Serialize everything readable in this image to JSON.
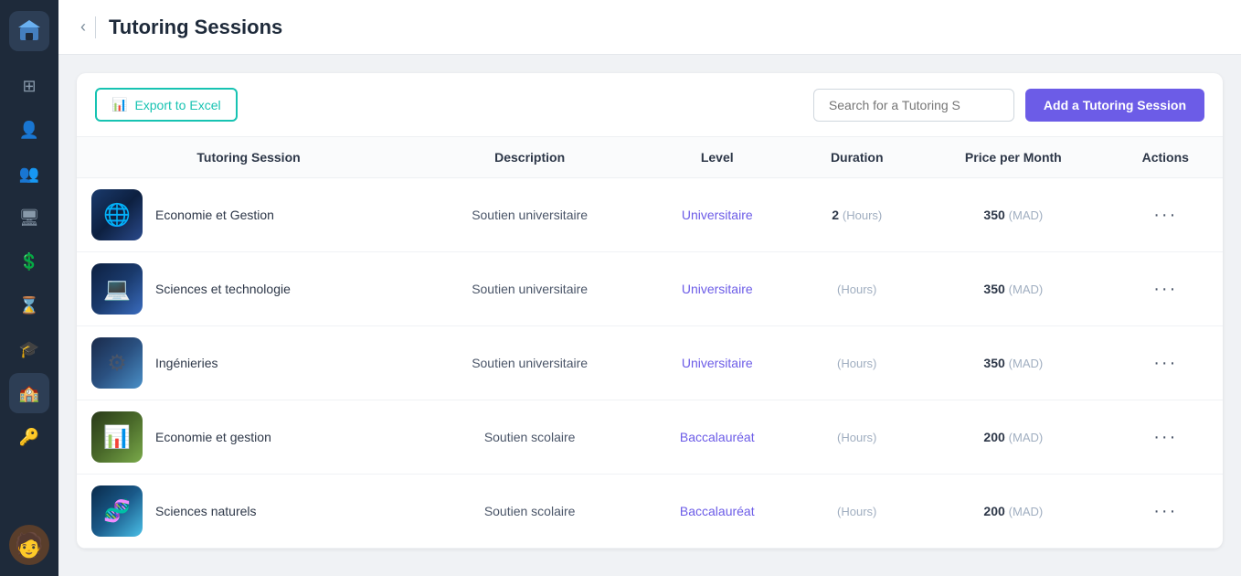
{
  "app": {
    "logo_icon": "🏛",
    "title": "Tutoring Sessions"
  },
  "sidebar": {
    "items": [
      {
        "id": "dashboard",
        "icon": "⊞",
        "label": "Dashboard"
      },
      {
        "id": "students",
        "icon": "👤",
        "label": "Students"
      },
      {
        "id": "people",
        "icon": "👥",
        "label": "People"
      },
      {
        "id": "monitor",
        "icon": "🖥",
        "label": "Monitor"
      },
      {
        "id": "finance",
        "icon": "💲",
        "label": "Finance"
      },
      {
        "id": "schedule",
        "icon": "⌛",
        "label": "Schedule"
      },
      {
        "id": "graduation",
        "icon": "🎓",
        "label": "Graduation"
      },
      {
        "id": "tutoring",
        "icon": "🏫",
        "label": "Tutoring",
        "active": true
      },
      {
        "id": "keys",
        "icon": "🔑",
        "label": "Keys"
      }
    ],
    "avatar_icon": "👤"
  },
  "toolbar": {
    "export_label": "Export to Excel",
    "export_icon": "📊",
    "search_placeholder": "Search for a Tutoring S",
    "add_label": "Add a Tutoring Session"
  },
  "table": {
    "columns": [
      {
        "id": "session",
        "label": "Tutoring Session"
      },
      {
        "id": "description",
        "label": "Description"
      },
      {
        "id": "level",
        "label": "Level"
      },
      {
        "id": "duration",
        "label": "Duration"
      },
      {
        "id": "price",
        "label": "Price per Month"
      },
      {
        "id": "actions",
        "label": "Actions"
      }
    ],
    "rows": [
      {
        "id": 1,
        "name": "Economie et Gestion",
        "thumb_class": "thumb-eco-uni",
        "thumb_icon": "🌐",
        "description": "Soutien universitaire",
        "level": "Universitaire",
        "duration_num": "2",
        "duration_unit": "(Hours)",
        "price_num": "350",
        "price_unit": "(MAD)"
      },
      {
        "id": 2,
        "name": "Sciences et technologie",
        "thumb_class": "thumb-sci-tech",
        "thumb_icon": "💻",
        "description": "Soutien universitaire",
        "level": "Universitaire",
        "duration_num": "",
        "duration_unit": "(Hours)",
        "price_num": "350",
        "price_unit": "(MAD)"
      },
      {
        "id": 3,
        "name": "Ingénieries",
        "thumb_class": "thumb-ing",
        "thumb_icon": "⚙",
        "description": "Soutien universitaire",
        "level": "Universitaire",
        "duration_num": "",
        "duration_unit": "(Hours)",
        "price_num": "350",
        "price_unit": "(MAD)"
      },
      {
        "id": 4,
        "name": "Economie et gestion",
        "thumb_class": "thumb-eco-bac",
        "thumb_icon": "📊",
        "description": "Soutien scolaire",
        "level": "Baccalauréat",
        "duration_num": "",
        "duration_unit": "(Hours)",
        "price_num": "200",
        "price_unit": "(MAD)"
      },
      {
        "id": 5,
        "name": "Sciences naturels",
        "thumb_class": "thumb-sci-nat",
        "thumb_icon": "🧬",
        "description": "Soutien scolaire",
        "level": "Baccalauréat",
        "duration_num": "",
        "duration_unit": "(Hours)",
        "price_num": "200",
        "price_unit": "(MAD)"
      }
    ]
  }
}
